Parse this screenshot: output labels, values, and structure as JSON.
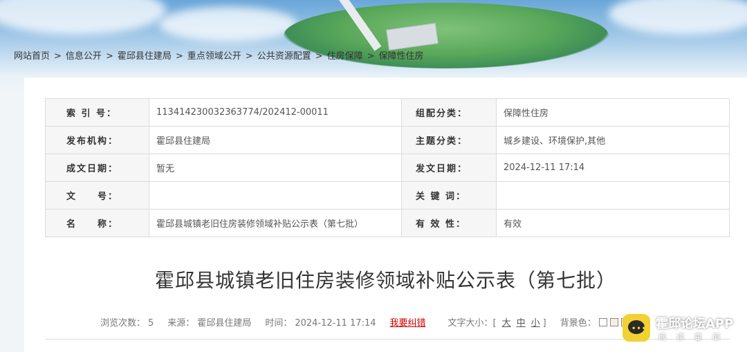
{
  "breadcrumb": {
    "items": [
      "网站首页",
      "信息公开",
      "霍邱县住建局",
      "重点领域公开",
      "公共资源配置",
      "住房保障",
      "保障性住房"
    ],
    "separator": ">"
  },
  "meta": {
    "rows": [
      {
        "l1": "索 引 号：",
        "v1": "113414230032363774/202412-00011",
        "l2": "组配分类：",
        "v2": "保障性住房"
      },
      {
        "l1": "发布机构：",
        "v1": "霍邱县住建局",
        "l2": "主题分类：",
        "v2": "城乡建设、环境保护,其他"
      },
      {
        "l1": "成文日期：",
        "v1": "暂无",
        "l2": "发文日期：",
        "v2": "2024-12-11 17:14"
      },
      {
        "l1": "文　　号：",
        "v1": "",
        "l2": "关 键 词：",
        "v2": ""
      },
      {
        "l1": "名　　称：",
        "v1": "霍邱县城镇老旧住房装修领域补贴公示表（第七批）",
        "l2": "有 效 性：",
        "v2": "有效"
      }
    ]
  },
  "article": {
    "title": "霍邱县城镇老旧住房装修领域补贴公示表（第七批）",
    "views_label": "浏览次数：",
    "views": "5",
    "source_label": "来源：",
    "source": "霍邱县住建局",
    "time_label": "时间：",
    "time": "2024-12-11 17:14",
    "report_error": "我要纠错",
    "font_size_label": "文字大小：[",
    "font_size_large": "大",
    "font_size_medium": "中",
    "font_size_small": "小",
    "font_size_end": "]",
    "bg_color_label": "背景色："
  },
  "bg_swatches": [
    "#ffffff",
    "#f5f0e1",
    "#f3e8c8",
    "#e6f2e6"
  ],
  "watermark": {
    "title": "霍邱论坛APP",
    "subtitle": "阅读霍邱",
    "icon": "chat-bubble-icon"
  },
  "colors": {
    "link_error": "#cc0000",
    "label_bg": "#f6f6f6"
  }
}
